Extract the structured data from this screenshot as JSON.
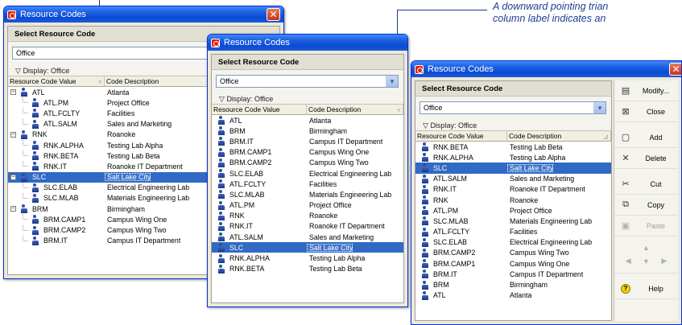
{
  "window_title": "Resource Codes",
  "select_header": "Select Resource Code",
  "combo_value": "Office",
  "display_label": "Display: Office",
  "col_value_header": "Resource Code Value",
  "col_desc_header": "Code Description",
  "callout": {
    "line1": "A downward pointing trian",
    "line2": "column label indicates an"
  },
  "window1": {
    "rows": [
      {
        "value": "ATL",
        "desc": "Atlanta",
        "level": 0,
        "expander": "−"
      },
      {
        "value": "ATL.PM",
        "desc": "Project Office",
        "level": 1
      },
      {
        "value": "ATL.FCLTY",
        "desc": "Facilities",
        "level": 1
      },
      {
        "value": "ATL.SALM",
        "desc": "Sales and Marketing",
        "level": 1
      },
      {
        "value": "RNK",
        "desc": "Roanoke",
        "level": 0,
        "expander": "−"
      },
      {
        "value": "RNK.ALPHA",
        "desc": "Testing Lab Alpha",
        "level": 1
      },
      {
        "value": "RNK.BETA",
        "desc": "Testing Lab Beta",
        "level": 1
      },
      {
        "value": "RNK.IT",
        "desc": "Roanoke IT Department",
        "level": 1
      },
      {
        "value": "SLC",
        "desc": "Salt Lake City",
        "level": 0,
        "expander": "−",
        "selected": true
      },
      {
        "value": "SLC.ELAB",
        "desc": "Electrical Engineering Lab",
        "level": 1
      },
      {
        "value": "SLC.MLAB",
        "desc": "Materials Engineering Lab",
        "level": 1
      },
      {
        "value": "BRM",
        "desc": "Birmingham",
        "level": 0,
        "expander": "−"
      },
      {
        "value": "BRM.CAMP1",
        "desc": "Campus Wing One",
        "level": 1
      },
      {
        "value": "BRM.CAMP2",
        "desc": "Campus Wing Two",
        "level": 1
      },
      {
        "value": "BRM.IT",
        "desc": "Campus IT Department",
        "level": 1
      }
    ]
  },
  "window2": {
    "rows": [
      {
        "value": "ATL",
        "desc": "Atlanta"
      },
      {
        "value": "BRM",
        "desc": "Birmingham"
      },
      {
        "value": "BRM.IT",
        "desc": "Campus IT Department"
      },
      {
        "value": "BRM.CAMP1",
        "desc": "Campus Wing One"
      },
      {
        "value": "BRM.CAMP2",
        "desc": "Campus Wing Two"
      },
      {
        "value": "SLC.ELAB",
        "desc": "Electrical Engineering Lab"
      },
      {
        "value": "ATL.FCLTY",
        "desc": "Facilities"
      },
      {
        "value": "SLC.MLAB",
        "desc": "Materials Engineering Lab"
      },
      {
        "value": "ATL.PM",
        "desc": "Project Office"
      },
      {
        "value": "RNK",
        "desc": "Roanoke"
      },
      {
        "value": "RNK.IT",
        "desc": "Roanoke IT Department"
      },
      {
        "value": "ATL.SALM",
        "desc": "Sales and Marketing"
      },
      {
        "value": "SLC",
        "desc": "Salt Lake City",
        "selected": true
      },
      {
        "value": "RNK.ALPHA",
        "desc": "Testing Lab Alpha"
      },
      {
        "value": "RNK.BETA",
        "desc": "Testing Lab Beta"
      }
    ]
  },
  "window3": {
    "rows": [
      {
        "value": "RNK.BETA",
        "desc": "Testing Lab Beta"
      },
      {
        "value": "RNK.ALPHA",
        "desc": "Testing Lab Alpha"
      },
      {
        "value": "SLC",
        "desc": "Salt Lake City",
        "selected": true
      },
      {
        "value": "ATL.SALM",
        "desc": "Sales and Marketing"
      },
      {
        "value": "RNK.IT",
        "desc": "Roanoke IT Department"
      },
      {
        "value": "RNK",
        "desc": "Roanoke"
      },
      {
        "value": "ATL.PM",
        "desc": "Project Office"
      },
      {
        "value": "SLC.MLAB",
        "desc": "Materials Engineering Lab"
      },
      {
        "value": "ATL.FCLTY",
        "desc": "Facilities"
      },
      {
        "value": "SLC.ELAB",
        "desc": "Electrical Engineering Lab"
      },
      {
        "value": "BRM.CAMP2",
        "desc": "Campus Wing Two"
      },
      {
        "value": "BRM.CAMP1",
        "desc": "Campus Wing One"
      },
      {
        "value": "BRM.IT",
        "desc": "Campus IT Department"
      },
      {
        "value": "BRM",
        "desc": "Birmingham"
      },
      {
        "value": "ATL",
        "desc": "Atlanta"
      }
    ],
    "toolbar": [
      {
        "label": "Modify...",
        "icon": "modify-icon",
        "glyph": "▤",
        "enabled": true
      },
      {
        "label": "Close",
        "icon": "close-icon",
        "glyph": "⊠",
        "enabled": true
      },
      {
        "label": "Add",
        "icon": "add-icon",
        "glyph": "▢",
        "enabled": true
      },
      {
        "label": "Delete",
        "icon": "delete-icon",
        "glyph": "✕",
        "enabled": true
      },
      {
        "label": "Cut",
        "icon": "cut-icon",
        "glyph": "✂",
        "enabled": true
      },
      {
        "label": "Copy",
        "icon": "copy-icon",
        "glyph": "⧉",
        "enabled": true
      },
      {
        "label": "Paste",
        "icon": "paste-icon",
        "glyph": "▣",
        "enabled": false
      }
    ],
    "help_label": "Help"
  },
  "colors": {
    "selection": "#316ac5",
    "titlebar": "#0a4ad6",
    "callout": "#1f3c8f"
  }
}
